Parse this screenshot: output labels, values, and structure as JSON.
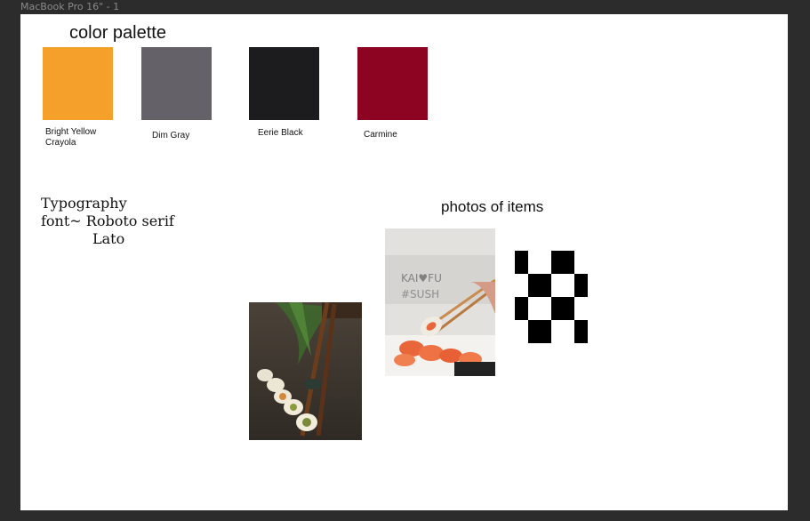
{
  "window": {
    "frame_title": "MacBook Pro 16\" - 1"
  },
  "palette": {
    "title": "color palette",
    "swatches": [
      {
        "name": "Bright Yellow Crayola",
        "color": "#f5a02a"
      },
      {
        "name": "Dim Gray",
        "color": "#646168"
      },
      {
        "name": "Eerie Black",
        "color": "#1c1c1e"
      },
      {
        "name": "Carmine",
        "color": "#8d0423"
      }
    ]
  },
  "typography": {
    "line1": "Typography",
    "line2": "font~ Roboto serif",
    "line3": "Lato"
  },
  "photos": {
    "heading": "photos of items",
    "images": [
      {
        "subject": "sushi rolls with chopsticks"
      },
      {
        "subject": "sushi held by chopsticks over platter"
      },
      {
        "subject": "black and white checkered pattern"
      }
    ]
  }
}
